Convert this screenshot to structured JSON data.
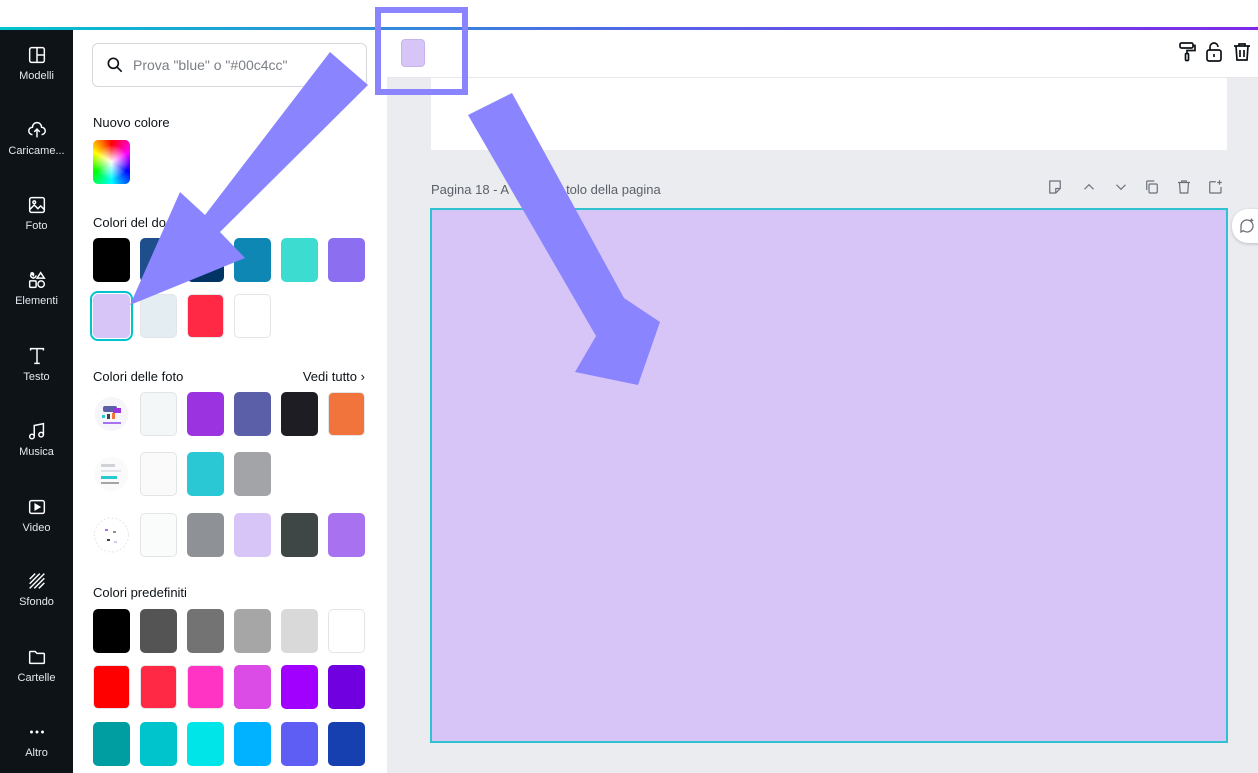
{
  "rail": {
    "items": [
      {
        "label": "Modelli",
        "icon": "layout-icon"
      },
      {
        "label": "Caricame...",
        "icon": "cloud-upload-icon"
      },
      {
        "label": "Foto",
        "icon": "image-icon"
      },
      {
        "label": "Elementi",
        "icon": "shapes-icon"
      },
      {
        "label": "Testo",
        "icon": "text-icon"
      },
      {
        "label": "Musica",
        "icon": "music-icon"
      },
      {
        "label": "Video",
        "icon": "video-icon"
      },
      {
        "label": "Sfondo",
        "icon": "background-icon"
      },
      {
        "label": "Cartelle",
        "icon": "folder-icon"
      },
      {
        "label": "Altro",
        "icon": "more-icon"
      }
    ]
  },
  "panel": {
    "search_placeholder": "Prova \"blue\" o \"#00c4cc\"",
    "new_color_title": "Nuovo colore",
    "doc_colors_title": "Colori del doc",
    "doc_colors_row1": [
      "#000000",
      "#1e4e8c",
      "#003464",
      "#0f87b4",
      "#3cdcd0",
      "#8c6ef0"
    ],
    "doc_colors_row2": [
      "#d8c5f8",
      "#e3edf2",
      "#ff2946",
      "#ffffff"
    ],
    "photo_colors_title": "Colori delle foto",
    "see_all": "Vedi tutto",
    "photo_rows": [
      [
        "#f4f7f8",
        "#9b34e0",
        "#5a5fa8",
        "#1f1d24",
        "#f0743c"
      ],
      [
        "#fafafa",
        "#2ac8d4",
        "#a3a4a7"
      ],
      [
        "#fafbfb",
        "#8e9195",
        "#d8c5f8",
        "#3e4646",
        "#a871f0"
      ]
    ],
    "preset_title": "Colori predefiniti",
    "preset_rows": [
      [
        "#000000",
        "#545454",
        "#737373",
        "#a6a6a6",
        "#d9d9d9",
        "#ffffff"
      ],
      [
        "#ff0000",
        "#ff2946",
        "#ff34c4",
        "#db4be5",
        "#a100ff",
        "#7000e0"
      ],
      [
        "#009ea0",
        "#00c4cc",
        "#00e5e8",
        "#00b2ff",
        "#5e5ef5",
        "#1640b0"
      ]
    ]
  },
  "topbar": {
    "swatch_color": "#d8c5f8",
    "icons": [
      "paint-roller-icon",
      "unlock-icon",
      "trash-icon"
    ]
  },
  "page": {
    "label_left": "Pagina 18 - A",
    "label_right": "tolo della pagina",
    "bg_color": "#d8c5f8",
    "tools": [
      "note-icon",
      "chevron-up-icon",
      "chevron-down-icon",
      "duplicate-icon",
      "trash-icon",
      "add-page-icon"
    ]
  },
  "annotation": {
    "highlight_color": "#8a85ff"
  }
}
